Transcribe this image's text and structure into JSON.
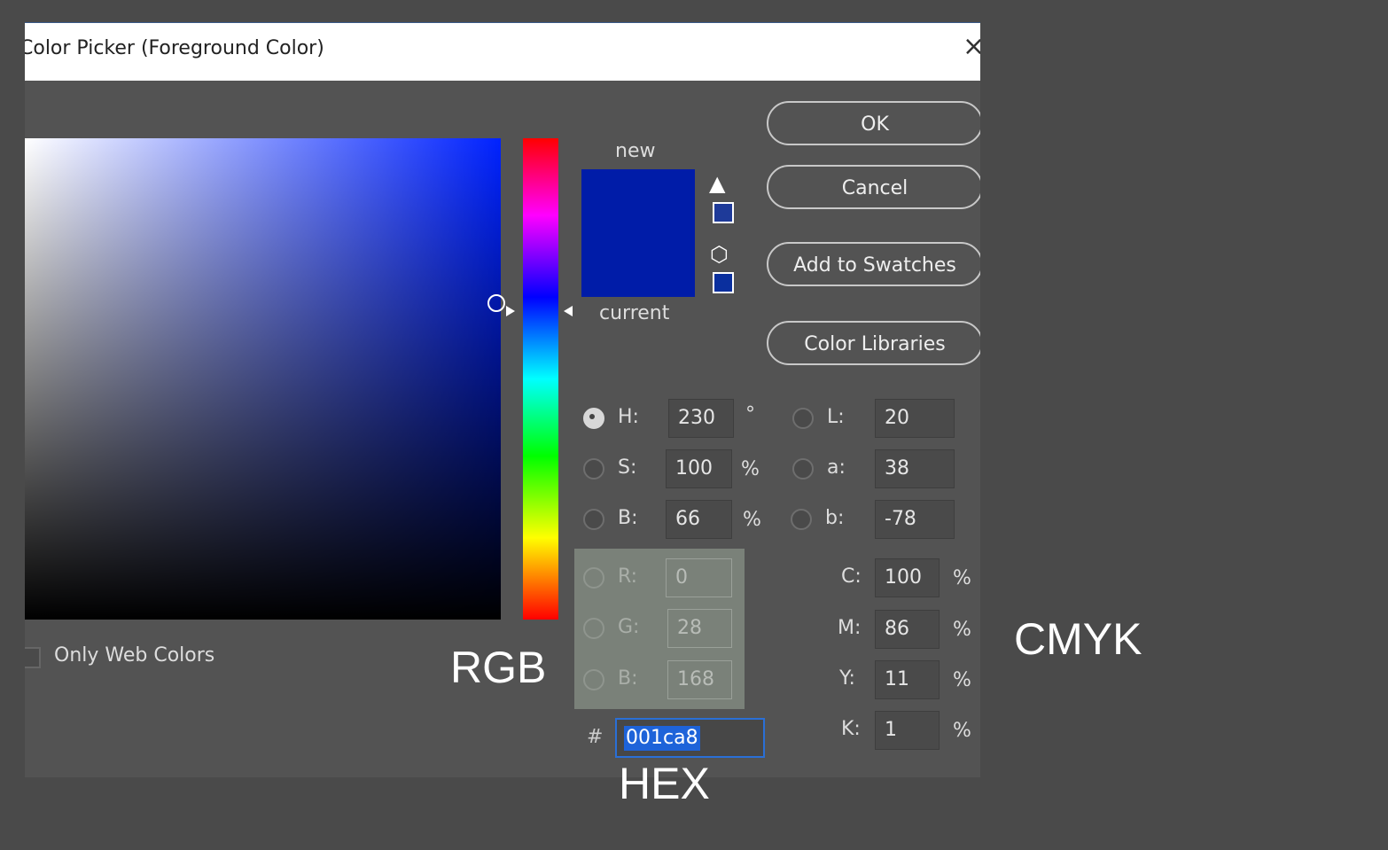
{
  "dialog": {
    "title": "Color Picker (Foreground Color)",
    "close_glyph": "×"
  },
  "preview": {
    "new_label": "new",
    "current_label": "current",
    "new_color": "#001ca8",
    "current_color": "#001ca8"
  },
  "gamut": {
    "warning_icon": "warning-icon",
    "warning_color": "#1e3a99",
    "websafe_icon": "cube-icon",
    "websafe_color": "#0a2f9e"
  },
  "buttons": {
    "ok": "OK",
    "cancel": "Cancel",
    "add_to_swatches": "Add to Swatches",
    "color_libraries": "Color Libraries"
  },
  "hsb": {
    "h": {
      "label": "H:",
      "value": "230",
      "unit": "°"
    },
    "s": {
      "label": "S:",
      "value": "100",
      "unit": "%"
    },
    "b": {
      "label": "B:",
      "value": "66",
      "unit": "%"
    }
  },
  "lab": {
    "l": {
      "label": "L:",
      "value": "20"
    },
    "a": {
      "label": "a:",
      "value": "38"
    },
    "b": {
      "label": "b:",
      "value": "-78"
    }
  },
  "rgb": {
    "r": {
      "label": "R:",
      "value": "0"
    },
    "g": {
      "label": "G:",
      "value": "28"
    },
    "b": {
      "label": "B:",
      "value": "168"
    }
  },
  "cmyk": {
    "c": {
      "label": "C:",
      "value": "100",
      "unit": "%"
    },
    "m": {
      "label": "M:",
      "value": "86",
      "unit": "%"
    },
    "y": {
      "label": "Y:",
      "value": "11",
      "unit": "%"
    },
    "k": {
      "label": "K:",
      "value": "1",
      "unit": "%"
    }
  },
  "hex": {
    "hash": "#",
    "value": "001ca8"
  },
  "only_web_colors": {
    "label": "Only Web Colors",
    "checked": false
  },
  "annotations": {
    "rgb": "RGB",
    "cmyk": "CMYK",
    "hex": "HEX"
  }
}
